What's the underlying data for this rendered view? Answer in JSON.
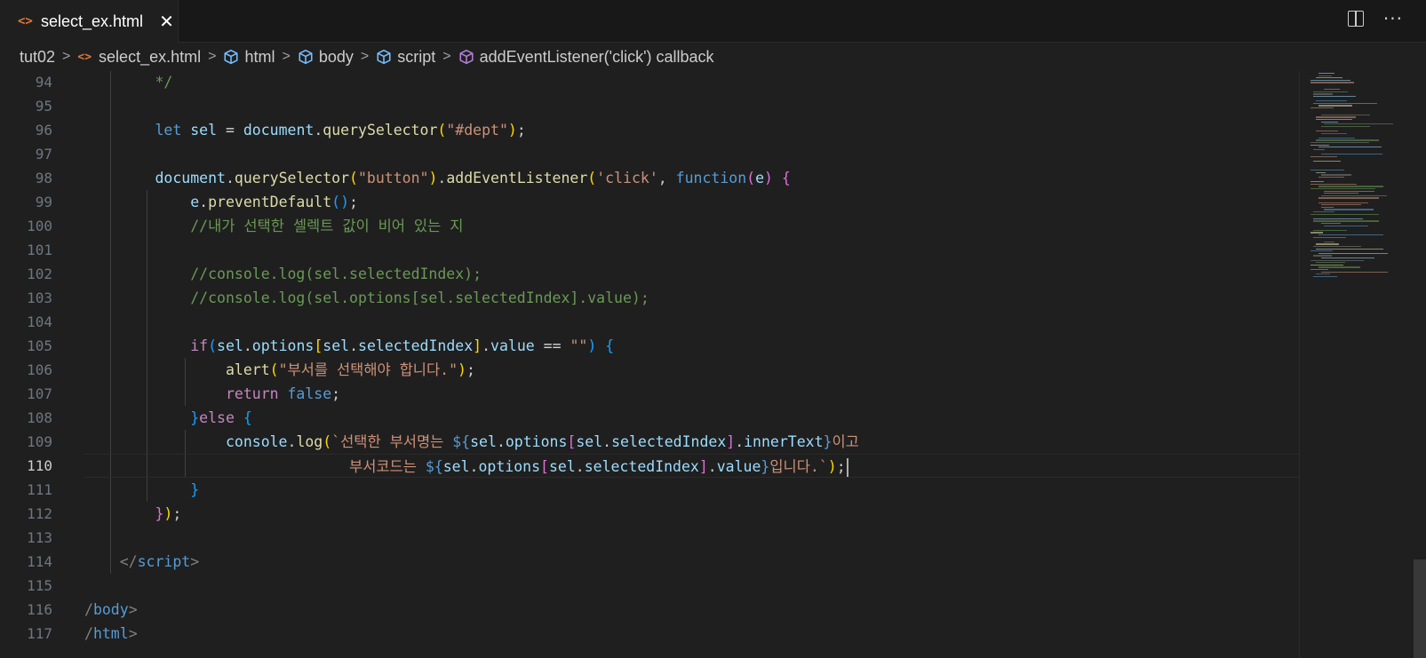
{
  "tab": {
    "title": "select_ex.html",
    "icon": "html-file-icon",
    "close_glyph": "✕"
  },
  "tab_actions": {
    "more_glyph": "···"
  },
  "breadcrumb": {
    "folder": "tut02",
    "file": "select_ex.html",
    "items": [
      "html",
      "body",
      "script",
      "addEventListener('click') callback"
    ]
  },
  "editor": {
    "first_line": 94,
    "current_line": 110,
    "line_numbers": [
      "94",
      "95",
      "96",
      "97",
      "98",
      "99",
      "100",
      "101",
      "102",
      "103",
      "104",
      "105",
      "106",
      "107",
      "108",
      "109",
      "110",
      "111",
      "112",
      "113",
      "114",
      "115",
      "116",
      "117"
    ],
    "lines": [
      [
        {
          "t": "        "
        },
        {
          "t": "*/",
          "c": "cm"
        }
      ],
      [],
      [
        {
          "t": "        "
        },
        {
          "t": "let",
          "c": "kw"
        },
        {
          "t": " "
        },
        {
          "t": "sel",
          "c": "var"
        },
        {
          "t": " = ",
          "c": "op"
        },
        {
          "t": "document",
          "c": "var"
        },
        {
          "t": "."
        },
        {
          "t": "querySelector",
          "c": "fn"
        },
        {
          "t": "(",
          "c": "p1"
        },
        {
          "t": "\"#dept\"",
          "c": "str"
        },
        {
          "t": ")",
          "c": "p1"
        },
        {
          "t": ";"
        }
      ],
      [],
      [
        {
          "t": "        "
        },
        {
          "t": "document",
          "c": "var"
        },
        {
          "t": "."
        },
        {
          "t": "querySelector",
          "c": "fn"
        },
        {
          "t": "(",
          "c": "p1"
        },
        {
          "t": "\"button\"",
          "c": "str"
        },
        {
          "t": ")",
          "c": "p1"
        },
        {
          "t": "."
        },
        {
          "t": "addEventListener",
          "c": "fn"
        },
        {
          "t": "(",
          "c": "p1"
        },
        {
          "t": "'click'",
          "c": "str"
        },
        {
          "t": ", "
        },
        {
          "t": "function",
          "c": "kw"
        },
        {
          "t": "(",
          "c": "p2"
        },
        {
          "t": "e",
          "c": "var"
        },
        {
          "t": ")",
          "c": "p2"
        },
        {
          "t": " "
        },
        {
          "t": "{",
          "c": "p2"
        }
      ],
      [
        {
          "t": "            "
        },
        {
          "t": "e",
          "c": "var"
        },
        {
          "t": "."
        },
        {
          "t": "preventDefault",
          "c": "fn"
        },
        {
          "t": "()",
          "c": "p3"
        },
        {
          "t": ";"
        }
      ],
      [
        {
          "t": "            "
        },
        {
          "t": "//내가 선택한 셀렉트 값이 비어 있는 지",
          "c": "cm"
        }
      ],
      [],
      [
        {
          "t": "            "
        },
        {
          "t": "//console.log(sel.selectedIndex);",
          "c": "cm"
        }
      ],
      [
        {
          "t": "            "
        },
        {
          "t": "//console.log(sel.options[sel.selectedIndex].value);",
          "c": "cm"
        }
      ],
      [],
      [
        {
          "t": "            "
        },
        {
          "t": "if",
          "c": "ctl"
        },
        {
          "t": "(",
          "c": "p3"
        },
        {
          "t": "sel",
          "c": "var"
        },
        {
          "t": "."
        },
        {
          "t": "options",
          "c": "var"
        },
        {
          "t": "[",
          "c": "p1"
        },
        {
          "t": "sel",
          "c": "var"
        },
        {
          "t": "."
        },
        {
          "t": "selectedIndex",
          "c": "var"
        },
        {
          "t": "]",
          "c": "p1"
        },
        {
          "t": "."
        },
        {
          "t": "value",
          "c": "var"
        },
        {
          "t": " == ",
          "c": "op"
        },
        {
          "t": "\"\"",
          "c": "str"
        },
        {
          "t": ")",
          "c": "p3"
        },
        {
          "t": " "
        },
        {
          "t": "{",
          "c": "p3"
        }
      ],
      [
        {
          "t": "                "
        },
        {
          "t": "alert",
          "c": "fn"
        },
        {
          "t": "(",
          "c": "p1"
        },
        {
          "t": "\"부서를 선택해야 합니다.\"",
          "c": "str"
        },
        {
          "t": ")",
          "c": "p1"
        },
        {
          "t": ";"
        }
      ],
      [
        {
          "t": "                "
        },
        {
          "t": "return",
          "c": "ctl"
        },
        {
          "t": " "
        },
        {
          "t": "false",
          "c": "kw"
        },
        {
          "t": ";"
        }
      ],
      [
        {
          "t": "            "
        },
        {
          "t": "}",
          "c": "p3"
        },
        {
          "t": "else",
          "c": "ctl"
        },
        {
          "t": " "
        },
        {
          "t": "{",
          "c": "p3"
        }
      ],
      [
        {
          "t": "                "
        },
        {
          "t": "console",
          "c": "var"
        },
        {
          "t": "."
        },
        {
          "t": "log",
          "c": "fn"
        },
        {
          "t": "(",
          "c": "p1"
        },
        {
          "t": "`선택한 부서명는 ",
          "c": "str"
        },
        {
          "t": "${",
          "c": "kw"
        },
        {
          "t": "sel",
          "c": "var"
        },
        {
          "t": "."
        },
        {
          "t": "options",
          "c": "var"
        },
        {
          "t": "[",
          "c": "p2"
        },
        {
          "t": "sel",
          "c": "var"
        },
        {
          "t": "."
        },
        {
          "t": "selectedIndex",
          "c": "var"
        },
        {
          "t": "]",
          "c": "p2"
        },
        {
          "t": "."
        },
        {
          "t": "innerText",
          "c": "var"
        },
        {
          "t": "}",
          "c": "kw"
        },
        {
          "t": "이고",
          "c": "str"
        }
      ],
      [
        {
          "t": "                              "
        },
        {
          "t": "부서코드는 ",
          "c": "str"
        },
        {
          "t": "${",
          "c": "kw"
        },
        {
          "t": "sel",
          "c": "var"
        },
        {
          "t": "."
        },
        {
          "t": "options",
          "c": "var"
        },
        {
          "t": "[",
          "c": "p2"
        },
        {
          "t": "sel",
          "c": "var"
        },
        {
          "t": "."
        },
        {
          "t": "selectedIndex",
          "c": "var"
        },
        {
          "t": "]",
          "c": "p2"
        },
        {
          "t": "."
        },
        {
          "t": "value",
          "c": "var"
        },
        {
          "t": "}",
          "c": "kw"
        },
        {
          "t": "입니다.`",
          "c": "str"
        },
        {
          "t": ")",
          "c": "p1"
        },
        {
          "t": ";"
        }
      ],
      [
        {
          "t": "            "
        },
        {
          "t": "}",
          "c": "p3"
        }
      ],
      [
        {
          "t": "        "
        },
        {
          "t": "}",
          "c": "p2"
        },
        {
          "t": ")",
          "c": "p1"
        },
        {
          "t": ";"
        }
      ],
      [],
      [
        {
          "t": "    "
        },
        {
          "t": "</",
          "c": "tb"
        },
        {
          "t": "script",
          "c": "tag"
        },
        {
          "t": ">",
          "c": "tb"
        }
      ],
      [],
      [
        {
          "t": "/",
          "c": "tb"
        },
        {
          "t": "body",
          "c": "tag"
        },
        {
          "t": ">",
          "c": "tb"
        }
      ],
      [
        {
          "t": "/",
          "c": "tb"
        },
        {
          "t": "html",
          "c": "tag"
        },
        {
          "t": ">",
          "c": "tb"
        }
      ]
    ]
  }
}
